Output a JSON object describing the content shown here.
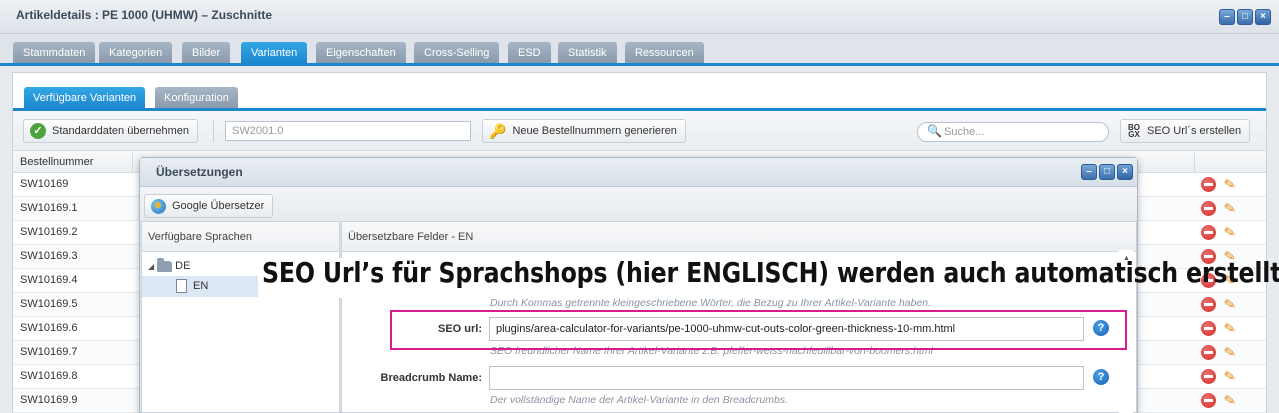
{
  "window": {
    "title": "Artikeldetails : PE 1000 (UHMW) – Zuschnitte"
  },
  "main_tabs": [
    "Stammdaten",
    "Kategorien",
    "Bilder",
    "Varianten",
    "Eigenschaften",
    "Cross-Selling",
    "ESD",
    "Statistik",
    "Ressourcen"
  ],
  "sub_tabs": [
    "Verfügbare Varianten",
    "Konfiguration"
  ],
  "toolbar": {
    "apply_defaults_label": "Standarddaten übernehmen",
    "order_number_value": "SW2001.0",
    "generate_numbers_label": "Neue Bestellnummern generieren",
    "search_placeholder": "Suche...",
    "seo_urls_label": "SEO Url´s erstellen",
    "seo_icon_text": "BO\nGX"
  },
  "grid": {
    "column_header": "Bestellnummer",
    "rows": [
      "SW10169",
      "SW10169.1",
      "SW10169.2",
      "SW10169.3",
      "SW10169.4",
      "SW10169.5",
      "SW10169.6",
      "SW10169.7",
      "SW10169.8",
      "SW10169.9"
    ]
  },
  "dialog": {
    "title": "Übersetzungen",
    "google_translate_label": "Google Übersetzer",
    "languages_header": "Verfügbare Sprachen",
    "fields_header": "Übersetzbare Felder - EN",
    "tree": {
      "parent": "DE",
      "child": "EN"
    },
    "keywords_hint": "Durch Kommas getrennte kleingeschriebene Wörter, die Bezug zu Ihrer Artikel-Variante haben.",
    "seo_url": {
      "label": "SEO url:",
      "value": "plugins/area-calculator-for-variants/pe-1000-uhmw-cut-outs-color-green-thickness-10-mm.html",
      "hint": "SEO freundlicher Name Ihrer Artikel-Variante z.B. pfeffer-weiss-nachfeuillbar-von-boomers.html"
    },
    "breadcrumb": {
      "label": "Breadcrumb Name:",
      "value": "",
      "hint": "Der vollständige Name der Artikel-Variante in den Breadcrumbs."
    }
  },
  "annotation": {
    "text": "SEO Url’s für Sprachshops (hier ENGLISCH) werden auch automatisch erstellt",
    "highlight_color": "#d81b8e"
  },
  "colors": {
    "accent": "#1b86cc",
    "delete": "#d12a2a",
    "edit": "#e88a1a"
  }
}
